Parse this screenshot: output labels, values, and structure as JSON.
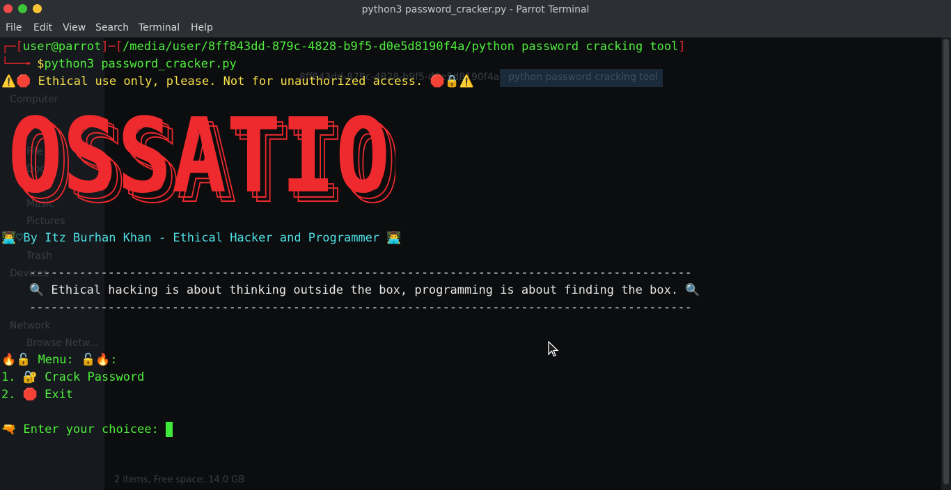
{
  "window": {
    "title": "python3 password_cracker.py - Parrot Terminal",
    "traffic_lights": {
      "close": "#f04a4a",
      "minimize": "#3ec43a",
      "maximize": "#f6c236"
    }
  },
  "menubar": {
    "items": [
      "File",
      "Edit",
      "View",
      "Search",
      "Terminal",
      "Help"
    ]
  },
  "terminal": {
    "prompt": {
      "user_host": "user@parrot",
      "path": "/media/user/8ff843dd-879c-4828-b9f5-d0e5d8190f4a/python password cracking tool",
      "dollar": "$",
      "command": "python3 password_cracker.py"
    },
    "warning": "⚠️🛑 Ethical use only, please. Not for unauthorized access. 🛑🔒⚠️",
    "banner": "OSSATIO",
    "credit": "👨‍💻♡By Itz Burhan Khan - Ethical Hacker and Programmer 👨‍💻",
    "divider": "---------------------------------------------------------------------------------------------",
    "quote": "🔍 Ethical hacking is about thinking outside the box, programming is about finding the box. 🔍",
    "menu_title": "🔥🔓 Menu: 🔓🔥:",
    "options": [
      "1. 🔐 Crack Password",
      "2. 🛑 Exit"
    ],
    "input_prompt": "🔫 Enter your choicee: "
  },
  "ghost": {
    "breadcrumb": "python password cracking tool",
    "sidebar": [
      "Computer",
      "File S",
      "Docu",
      "Music",
      "Pictures",
      "Trash",
      "Devices",
      "Network",
      "Browse Netw..."
    ],
    "status": "2 items, Free space: 14.0 GB",
    "breadcrumb_path": "8ff843dd-879c-4828-b9f5-d0e5d8190f4a"
  },
  "colors": {
    "green": "#4ef03c",
    "red": "#e3262a",
    "yellow": "#f6e04a",
    "cyan": "#4ee1e6",
    "banner_red": "#ee2a2e"
  }
}
